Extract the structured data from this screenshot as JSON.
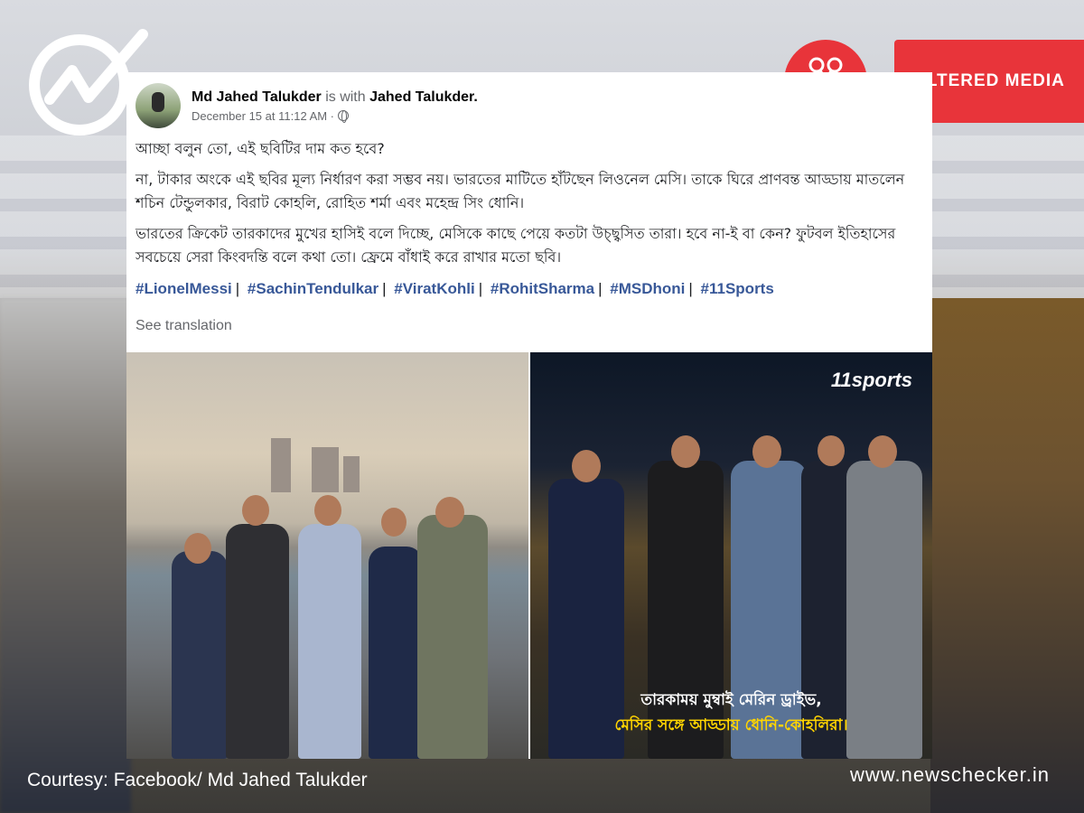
{
  "watermark": {
    "badge_label": "ALTERED MEDIA",
    "logo_icon": "newschecker-check-icon",
    "badge_icon": "scissors-icon",
    "accent_color": "#e8343a"
  },
  "post": {
    "author": "Md Jahed Talukder",
    "with_text": "is with",
    "tagged": "Jahed Talukder.",
    "timestamp": "December 15 at 11:12 AM ·",
    "privacy_icon": "globe-icon",
    "paragraphs": [
      "আচ্ছা বলুন তো, এই ছবিটির দাম কত হবে?",
      "না, টাকার অংকে এই ছবির মূল্য নির্ধারণ করা সম্ভব নয়। ভারতের মাটিতে হাঁটছেন লিওনেল মেসি। তাকে ঘিরে প্রাণবন্ত আড্ডায় মাতলেন শচিন টেন্ডুলকার, বিরাট কোহলি, রোহিত শর্মা এবং মহেন্দ্র সিং ধোনি।",
      "ভারতের ক্রিকেট তারকাদের মুখের হাসিই বলে দিচ্ছে, মেসিকে কাছে পেয়ে কতটা উচ্ছ্বসিত তারা। হবে না-ই বা কেন? ফুটবল ইতিহাসের সবচেয়ে সেরা কিংবদন্তি বলে কথা তো। ফ্রেমে বাঁধাই করে রাখার মতো ছবি।"
    ],
    "hashtags": [
      "#LionelMessi",
      "#SachinTendulkar",
      "#ViratKohli",
      "#RohitSharma",
      "#MSDhoni",
      "#11Sports"
    ],
    "see_translation": "See translation"
  },
  "right_photo": {
    "logo": "11sports",
    "caption_line1": "তারকাময় মুম্বাই মেরিন ড্রাইভ,",
    "caption_line2": "মেসির সঙ্গে আড্ডায় ধোনি-কোহলিরা।"
  },
  "footer": {
    "courtesy": "Courtesy: Facebook/ Md Jahed Talukder",
    "site": "www.newschecker.in"
  }
}
